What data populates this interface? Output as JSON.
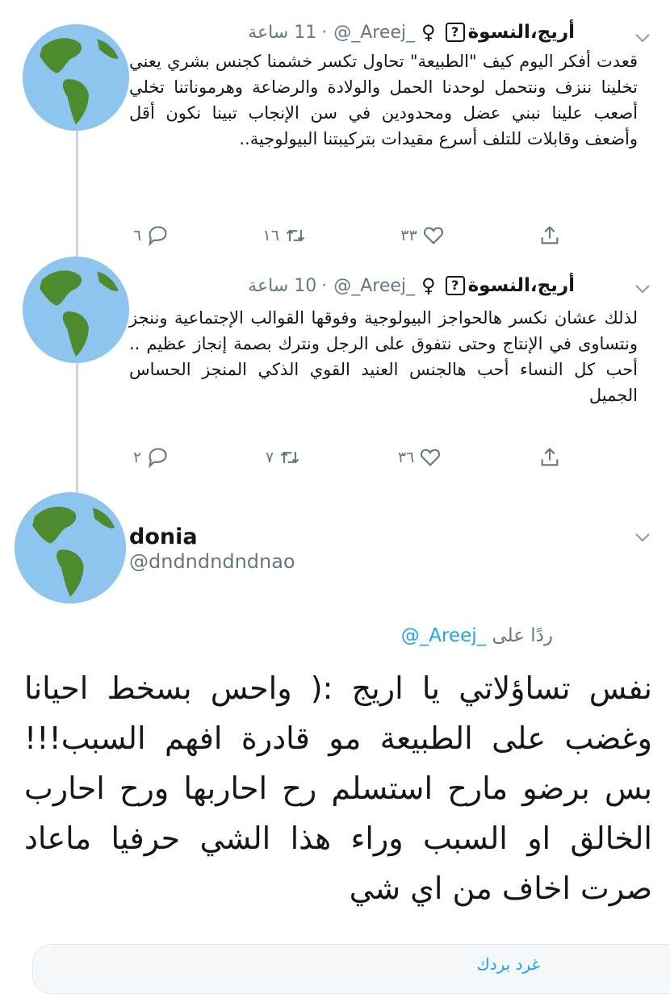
{
  "colors": {
    "accent": "#1da1f2",
    "muted": "#657786",
    "text": "#14171a",
    "avatar_globe_land": "#4e8a2e",
    "avatar_ocean": "#8ec5ef"
  },
  "tweets": [
    {
      "name": "أريج،النسوة",
      "badge_icon": "?",
      "gender_icon": "♀",
      "handle": "@_Areej_",
      "separator": "·",
      "time": "11 ساعة",
      "text": "قعدت أفكر اليوم كيف \"الطبيعة\" تحاول تكسر خشمنا كجنس بشري يعني تخلينا ننزف ونتحمل لوحدنا الحمل والولادة والرضاعة وهرموناتنا تخلي أصعب علينا نبني عضل ومحدودين في سن الإنجاب تبينا نكون أقل وأضعف وقابلات للتلف أسرع مقيدات بتركيبتنا البيولوجية..",
      "replies": "٦",
      "retweets": "١٦",
      "likes": "٣٣"
    },
    {
      "name": "أريج،النسوة",
      "badge_icon": "?",
      "gender_icon": "♀",
      "handle": "@_Areej_",
      "separator": "·",
      "time": "10 ساعة",
      "text": "لذلك عشان نكسر هالحواجز البيولوجية وفوقها القوالب الإجتماعية وننجز ونتساوى في الإنتاج وحتى نتفوق على الرجل ونترك بصمة إنجاز عظيم .. أحب كل النساء أحب هالجنس العنيد القوي الذكي المنجز الحساس الجميل",
      "replies": "٢",
      "retweets": "٧",
      "likes": "٣٦"
    }
  ],
  "reply_tweet": {
    "name": "donia",
    "handle": "@dndndndndnao",
    "replying_to_label": "ردًا على",
    "replying_to_handle": "@_Areej_",
    "text": "نفس تساؤلاتي يا اريج :( واحس بسخط احيانا وغضب على الطبيعة مو قادرة افهم السبب!!! بس برضو مارح استسلم رح احاربها ورح احارب الخالق او السبب وراء هذا الشي حرفيا ماعاد صرت اخاف من اي شي"
  },
  "bottom_bar": {
    "text": "غرد بردك"
  }
}
